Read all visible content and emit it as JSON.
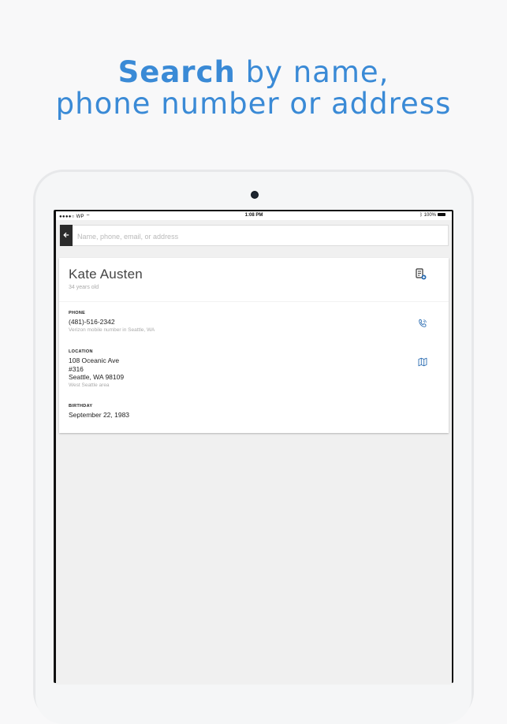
{
  "headline": {
    "line1_bold": "Search",
    "line1_rest": " by name,",
    "line2": "phone number or address"
  },
  "status_bar": {
    "carrier": "●●●●○ WP",
    "time": "1:08 PM",
    "battery": "100%"
  },
  "search": {
    "placeholder": "Name, phone, email, or address",
    "value": ""
  },
  "person": {
    "name": "Kate Austen",
    "age": "34 years old",
    "phone": {
      "label": "PHONE",
      "number": "(481)-516-2342",
      "detail": "Verizon mobile number in Seattle, WA"
    },
    "location": {
      "label": "LOCATION",
      "line1": "108 Oceanic Ave",
      "line2": "#316",
      "line3": "Seattle, WA 98109",
      "detail": "West Seattle area"
    },
    "birthday": {
      "label": "BIRTHDAY",
      "value": "September 22, 1983"
    }
  },
  "colors": {
    "accent": "#3a8ad6",
    "icon_blue": "#2f6fb3",
    "dark_button": "#2b2b2b"
  },
  "icons": {
    "back": "arrow-left-icon",
    "contact": "contact-card-icon",
    "phone": "phone-icon",
    "map": "map-icon",
    "wifi": "wifi-icon",
    "bluetooth": "bluetooth-icon",
    "battery": "battery-icon"
  }
}
